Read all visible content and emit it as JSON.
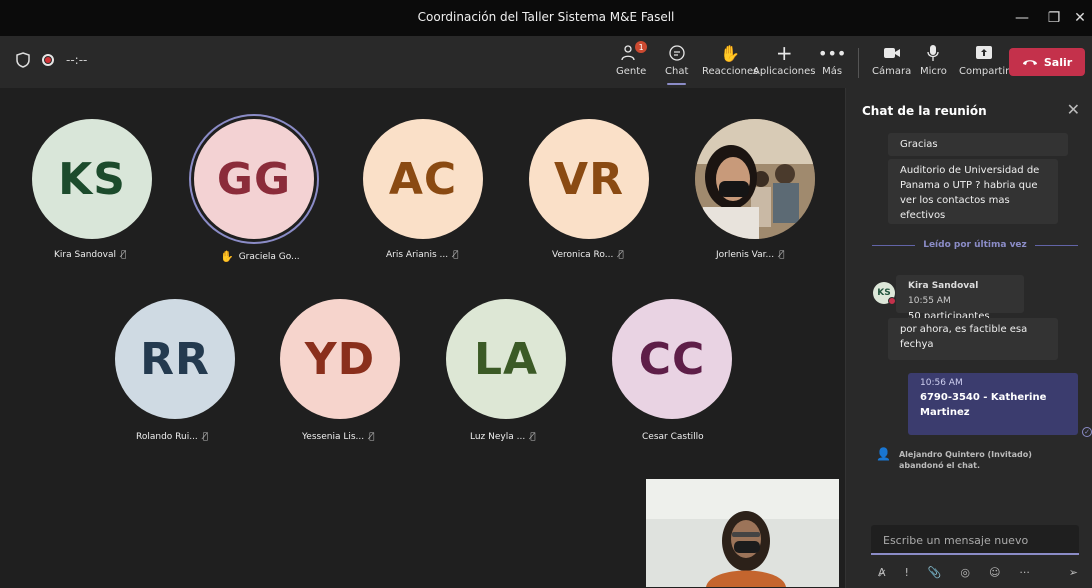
{
  "window": {
    "title": "Coordinación del Taller Sistema M&E Fasell",
    "minimize_icon": "minimize-icon",
    "maximize_icon": "maximize-icon",
    "close_icon": "close-icon"
  },
  "toolbar": {
    "timer": "--:--",
    "buttons": [
      {
        "label": "Gente",
        "icon": "people-icon",
        "badge": "1"
      },
      {
        "label": "Chat",
        "icon": "chat-icon",
        "active": true
      },
      {
        "label": "Reacciones",
        "icon": "raise-hand-icon"
      },
      {
        "label": "Aplicaciones",
        "icon": "plus-icon"
      },
      {
        "label": "Más",
        "icon": "more-icon"
      },
      {
        "label": "Cámara",
        "icon": "camera-icon"
      },
      {
        "label": "Micro",
        "icon": "microphone-icon"
      },
      {
        "label": "Compartir",
        "icon": "share-icon"
      }
    ],
    "leave_label": "Salir"
  },
  "participants": [
    {
      "initials": "KS",
      "name": "Kira Sandoval",
      "bg": "#d9e6d9",
      "fg": "#1c4b2c"
    },
    {
      "initials": "GG",
      "name": "Graciela Go...",
      "bg": "#f3d2d3",
      "fg": "#8b2c3a",
      "hand_raised": true
    },
    {
      "initials": "AC",
      "name": "Aris Arianis ...",
      "bg": "#fae0c8",
      "fg": "#8a4a12"
    },
    {
      "initials": "VR",
      "name": "Veronica Ro...",
      "bg": "#fae0c8",
      "fg": "#8a4a12"
    },
    {
      "initials": "",
      "name": "Jorlenis Var...",
      "photo": true
    },
    {
      "initials": "RR",
      "name": "Rolando Rui...",
      "bg": "#cfdae3",
      "fg": "#243a4f"
    },
    {
      "initials": "YD",
      "name": "Yessenia Lis...",
      "bg": "#f6d4cc",
      "fg": "#8a2f1c"
    },
    {
      "initials": "LA",
      "name": "Luz Neyla ...",
      "bg": "#dde7d5",
      "fg": "#3b5a26"
    },
    {
      "initials": "CC",
      "name": "Cesar Castillo",
      "bg": "#e9d3e3",
      "fg": "#5e1e48"
    }
  ],
  "chat": {
    "header": "Chat de la reunión",
    "messages": {
      "m1": "Gracias",
      "m2": "Auditorio de Universidad de Panama o UTP ? habria que ver los contactos mas efectivos",
      "last_read": "Leído por última vez",
      "sender": "Kira Sandoval",
      "sender_initials": "KS",
      "sender_time": "10:55 AM",
      "m3": "50 participantes",
      "m4": "por ahora, es factible esa fechya",
      "mine_time": "10:56 AM",
      "mine_msg": "6790-3540 - Katherine Martinez",
      "system": "Alejandro Quintero (Invitado) abandonó el chat."
    },
    "compose_placeholder": "Escribe un mensaje nuevo"
  }
}
